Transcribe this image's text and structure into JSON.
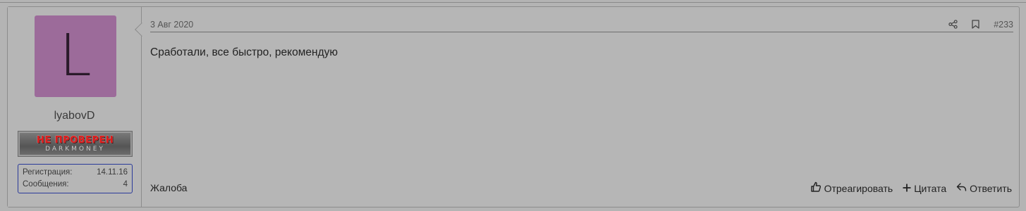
{
  "post": {
    "date": "3 Авг 2020",
    "post_number": "#233",
    "content": "Сработали, все быстро, рекомендую",
    "report_label": "Жалоба",
    "actions": {
      "react_label": "Отреагировать",
      "quote_label": "Цитата",
      "reply_label": "Ответить"
    }
  },
  "user": {
    "avatar_letter": "L",
    "avatar_color": "#9c6b9a",
    "username": "lyabovD",
    "badge": {
      "main": "НЕ ПРОВЕРЕН",
      "sub": "DARKMONEY"
    },
    "stats": [
      {
        "label": "Регистрация:",
        "value": "14.11.16"
      },
      {
        "label": "Сообщения:",
        "value": "4"
      }
    ]
  },
  "icons": {
    "share": "share-icon",
    "bookmark": "bookmark-icon",
    "thumbs_up": "thumbs-up-icon",
    "plus": "plus-icon",
    "reply": "reply-icon"
  }
}
